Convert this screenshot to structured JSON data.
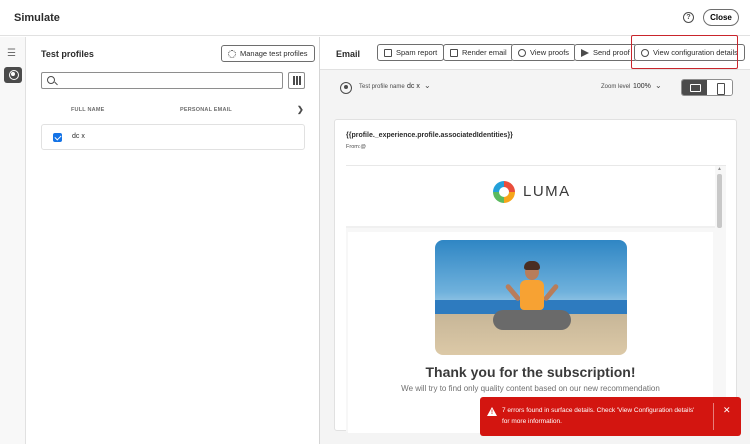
{
  "header": {
    "title": "Simulate",
    "close_label": "Close"
  },
  "left_panel": {
    "title": "Test profiles",
    "manage_button": "Manage test profiles",
    "search_placeholder": "",
    "columns": [
      "FULL NAME",
      "PERSONAL EMAIL"
    ],
    "rows": [
      {
        "full_name": "dc x",
        "selected": true
      }
    ]
  },
  "right_panel": {
    "title": "Email",
    "actions": [
      {
        "label": "Spam report",
        "icon": "spam-report-icon"
      },
      {
        "label": "Render email",
        "icon": "render-email-icon"
      },
      {
        "label": "View proofs",
        "icon": "history-icon"
      },
      {
        "label": "Send proof",
        "icon": "send-icon"
      },
      {
        "label": "View configuration details",
        "icon": "configuration-icon"
      }
    ],
    "test_profile_label": "Test profile name",
    "test_profile_value": "dc x",
    "zoom_label": "Zoom level",
    "zoom_value": "100%",
    "preview": {
      "subject": "{{profile._experience.profile.associatedIdentities}}",
      "from": "From:@",
      "logo_text": "LUMA",
      "heading": "Thank you for the subscription!",
      "paragraph": "We will try to find only quality content based on our new recommendation"
    }
  },
  "toast": {
    "message": "7 errors found in surface details. Check 'View Configuration details' for more information.",
    "color": "#d31510"
  },
  "colors": {
    "accent": "#1473e6",
    "error": "#d31510",
    "highlight": "#c9252c"
  }
}
